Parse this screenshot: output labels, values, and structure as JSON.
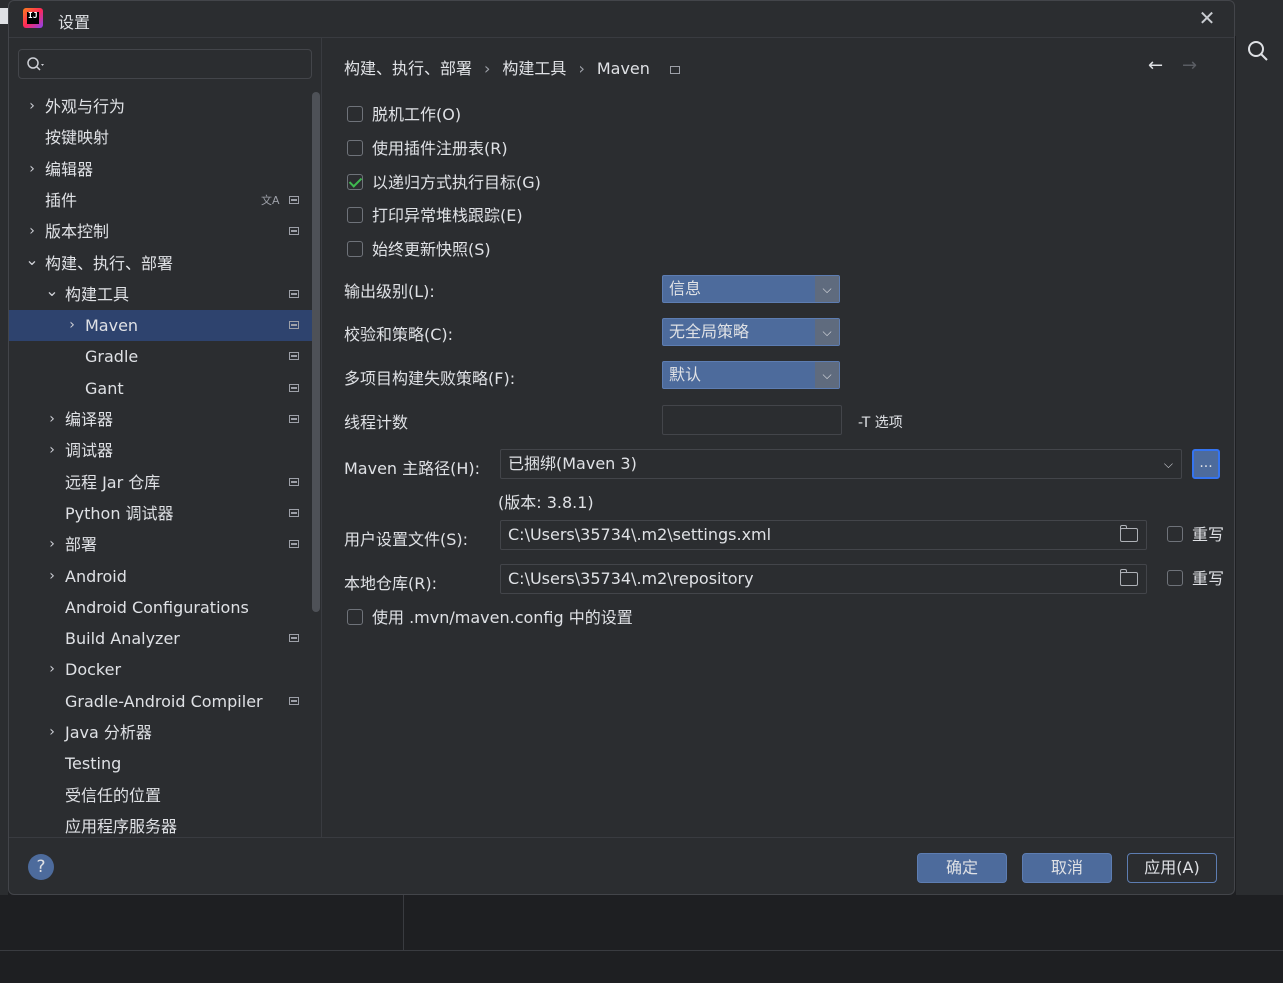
{
  "window": {
    "title": "设置",
    "logo_text": "IJ"
  },
  "sidebar": {
    "search_placeholder": "",
    "items": [
      {
        "label": "外观与行为",
        "expandable": true,
        "expanded": false,
        "level": 0,
        "project_icon": false
      },
      {
        "label": "按键映射",
        "expandable": false,
        "level": 0,
        "project_icon": false
      },
      {
        "label": "编辑器",
        "expandable": true,
        "expanded": false,
        "level": 0,
        "project_icon": false
      },
      {
        "label": "插件",
        "expandable": false,
        "level": 0,
        "project_icon": true,
        "translate_icon": true
      },
      {
        "label": "版本控制",
        "expandable": true,
        "expanded": false,
        "level": 0,
        "project_icon": true
      },
      {
        "label": "构建、执行、部署",
        "expandable": true,
        "expanded": true,
        "level": 0,
        "project_icon": false
      },
      {
        "label": "构建工具",
        "expandable": true,
        "expanded": true,
        "level": 1,
        "project_icon": true
      },
      {
        "label": "Maven",
        "expandable": true,
        "expanded": false,
        "level": 2,
        "project_icon": true,
        "selected": true
      },
      {
        "label": "Gradle",
        "expandable": false,
        "level": 2,
        "project_icon": true
      },
      {
        "label": "Gant",
        "expandable": false,
        "level": 2,
        "project_icon": true
      },
      {
        "label": "编译器",
        "expandable": true,
        "expanded": false,
        "level": 1,
        "project_icon": true
      },
      {
        "label": "调试器",
        "expandable": true,
        "expanded": false,
        "level": 1,
        "project_icon": false
      },
      {
        "label": "远程 Jar 仓库",
        "expandable": false,
        "level": 1,
        "project_icon": true
      },
      {
        "label": "Python 调试器",
        "expandable": false,
        "level": 1,
        "project_icon": true
      },
      {
        "label": "部署",
        "expandable": true,
        "expanded": false,
        "level": 1,
        "project_icon": true
      },
      {
        "label": "Android",
        "expandable": true,
        "expanded": false,
        "level": 1,
        "project_icon": false
      },
      {
        "label": "Android Configurations",
        "expandable": false,
        "level": 1,
        "project_icon": false
      },
      {
        "label": "Build Analyzer",
        "expandable": false,
        "level": 1,
        "project_icon": true
      },
      {
        "label": "Docker",
        "expandable": true,
        "expanded": false,
        "level": 1,
        "project_icon": false
      },
      {
        "label": "Gradle-Android Compiler",
        "expandable": false,
        "level": 1,
        "project_icon": true
      },
      {
        "label": "Java 分析器",
        "expandable": true,
        "expanded": false,
        "level": 1,
        "project_icon": false
      },
      {
        "label": "Testing",
        "expandable": false,
        "level": 1,
        "project_icon": false
      },
      {
        "label": "受信任的位置",
        "expandable": false,
        "level": 1,
        "project_icon": false
      },
      {
        "label": "应用程序服务器",
        "expandable": false,
        "level": 1,
        "project_icon": false
      }
    ]
  },
  "breadcrumb": {
    "items": [
      "构建、执行、部署",
      "构建工具",
      "Maven"
    ],
    "separator": "›"
  },
  "nav": {
    "back": "←",
    "forward": "→"
  },
  "checkboxes": {
    "offline": {
      "label": "脱机工作(O)",
      "checked": false
    },
    "plugin_registry": {
      "label": "使用插件注册表(R)",
      "checked": false
    },
    "recursive": {
      "label": "以递归方式执行目标(G)",
      "checked": true
    },
    "print_stack": {
      "label": "打印异常堆栈跟踪(E)",
      "checked": false
    },
    "always_update": {
      "label": "始终更新快照(S)",
      "checked": false
    },
    "use_mvn_config": {
      "label": "使用 .mvn/maven.config 中的设置",
      "checked": false
    }
  },
  "fields": {
    "output_level": {
      "label": "输出级别(L):",
      "value": "信息"
    },
    "checksum_policy": {
      "label": "校验和策略(C):",
      "value": "无全局策略"
    },
    "multiproject_fail": {
      "label": "多项目构建失败策略(F):",
      "value": "默认"
    },
    "thread_count": {
      "label": "线程计数",
      "value": "",
      "suffix": "-T 选项"
    },
    "maven_home": {
      "label": "Maven 主路径(H):",
      "value": "已捆绑(Maven 3)",
      "browse": "...",
      "version": "(版本: 3.8.1)"
    },
    "user_settings": {
      "label": "用户设置文件(S):",
      "value": "C:\\Users\\35734\\.m2\\settings.xml",
      "override": "重写"
    },
    "local_repo": {
      "label": "本地仓库(R):",
      "value": "C:\\Users\\35734\\.m2\\repository",
      "override": "重写"
    }
  },
  "footer": {
    "help": "?",
    "ok": "确定",
    "cancel": "取消",
    "apply": "应用(A)"
  },
  "colors": {
    "selection": "#2e436e",
    "accent": "#3574f0",
    "button": "#4d6b9c",
    "check": "#3fb950"
  }
}
